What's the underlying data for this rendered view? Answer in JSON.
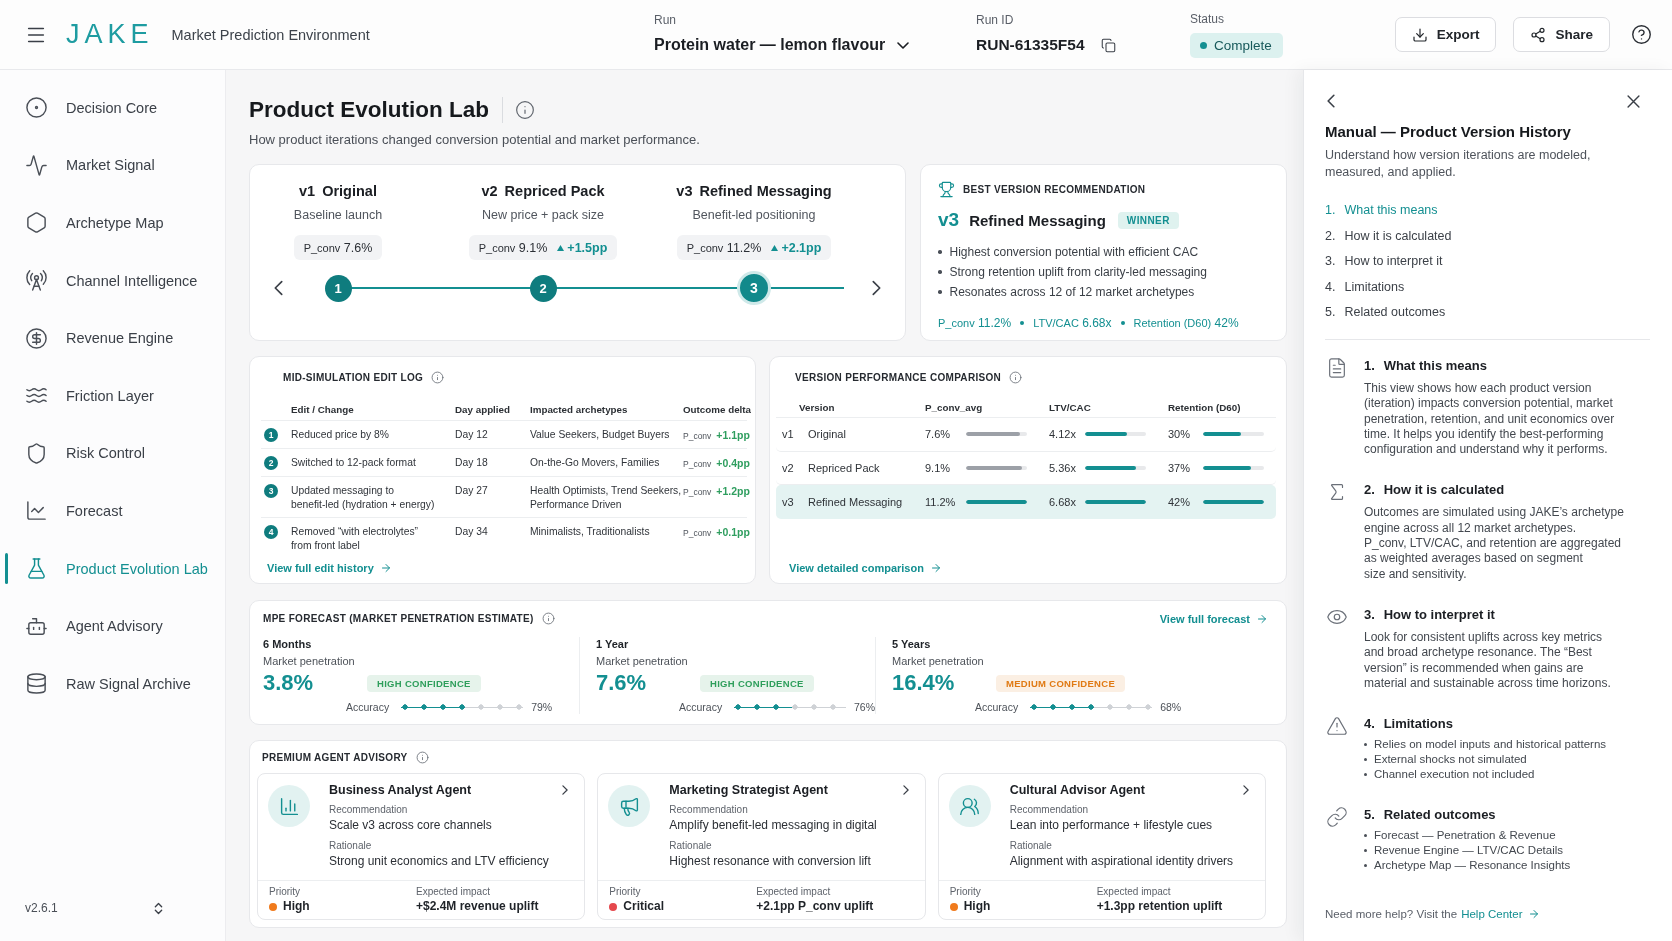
{
  "topbar": {
    "logo": "JAKE",
    "subtitle": "Market Prediction Environment",
    "run": {
      "label": "Run",
      "value": "Protein water — lemon flavour"
    },
    "run_id": {
      "label": "Run ID",
      "value": "RUN-61335F54"
    },
    "status": {
      "label": "Status",
      "value": "Complete"
    },
    "actions": [
      {
        "label": "Export"
      },
      {
        "label": "Share"
      }
    ]
  },
  "sidebar": {
    "items": [
      {
        "label": "Decision Core",
        "selected": false
      },
      {
        "label": "Market Signal",
        "selected": false
      },
      {
        "label": "Archetype Map",
        "selected": false
      },
      {
        "label": "Channel Intelligence",
        "selected": false
      },
      {
        "label": "Revenue Engine",
        "selected": false
      },
      {
        "label": "Friction Layer",
        "selected": false
      },
      {
        "label": "Risk Control",
        "selected": false
      },
      {
        "label": "Forecast",
        "selected": false
      },
      {
        "label": "Product Evolution Lab",
        "selected": true
      },
      {
        "label": "Agent Advisory",
        "selected": false
      },
      {
        "label": "Raw Signal Archive",
        "selected": false
      }
    ],
    "version": "v2.6.1"
  },
  "header": {
    "title": "Product Evolution Lab",
    "subtitle": "How product iterations changed conversion potential and market performance."
  },
  "timeline": {
    "versions": [
      {
        "tag": "v1",
        "name": "Original",
        "description": "Baseline launch",
        "metric": "P_conv",
        "value": "7.6%",
        "step": "1",
        "selected": false
      },
      {
        "tag": "v2",
        "name": "Repriced Pack",
        "description": "New price + pack size",
        "metric": "P_conv",
        "value": "9.1%",
        "delta": "+1.5pp",
        "step": "2",
        "selected": false
      },
      {
        "tag": "v3",
        "name": "Refined Messaging",
        "description": "Benefit-led positioning",
        "metric": "P_conv",
        "value": "11.2%",
        "delta": "+2.1pp",
        "step": "3",
        "selected": true
      }
    ]
  },
  "best_version": {
    "title": "BEST VERSION RECOMMENDATION",
    "tag": "v3",
    "name": "Refined Messaging",
    "badge": "WINNER",
    "points": [
      "Highest conversion potential with efficient CAC",
      "Strong retention uplift from clarity-led messaging",
      "Resonates across 12 of 12 market archetypes"
    ],
    "metrics": [
      {
        "label": "P_conv",
        "value": "11.2%"
      },
      {
        "label": "LTV/CAC",
        "value": "6.68x"
      },
      {
        "label": "Retention (D60)",
        "value": "42%"
      }
    ]
  },
  "edit_log": {
    "title": "MID-SIMULATION EDIT LOG",
    "columns": [
      "Edit / Change",
      "Day applied",
      "Impacted archetypes",
      "Outcome delta"
    ],
    "rows": [
      {
        "step": "1",
        "change": "Reduced price by 8%",
        "day": "Day 12",
        "archetypes": "Value Seekers, Budget Buyers",
        "metric": "P_conv",
        "delta": "+1.1pp"
      },
      {
        "step": "2",
        "change": "Switched to 12-pack format",
        "day": "Day 18",
        "archetypes": "On-the-Go Movers, Families",
        "metric": "P_conv",
        "delta": "+0.4pp"
      },
      {
        "step": "3",
        "change": "Updated messaging to\nbenefit-led (hydration + energy)",
        "day": "Day 27",
        "archetypes": "Health Optimists, Trend Seekers,\nPerformance Driven",
        "metric": "P_conv",
        "delta": "+1.2pp"
      },
      {
        "step": "4",
        "change": "Removed “with electrolytes”\nfrom front label",
        "day": "Day 34",
        "archetypes": "Minimalists, Traditionalists",
        "metric": "P_conv",
        "delta": "+0.1pp"
      }
    ],
    "link": "View full edit history"
  },
  "comparison": {
    "title": "VERSION PERFORMANCE COMPARISON",
    "columns": [
      "Version",
      "P_conv_avg",
      "LTV/CAC",
      "Retention (D60)"
    ],
    "rows": [
      {
        "tag": "v1",
        "name": "Original",
        "selected": false,
        "metrics": [
          {
            "value": "7.6%",
            "level": 0.88
          },
          {
            "value": "4.12x",
            "level": 0.69
          },
          {
            "value": "30%",
            "level": 0.63
          }
        ]
      },
      {
        "tag": "v2",
        "name": "Repriced Pack",
        "selected": false,
        "metrics": [
          {
            "value": "9.1%",
            "level": 0.92
          },
          {
            "value": "5.36x",
            "level": 0.83
          },
          {
            "value": "37%",
            "level": 0.79
          }
        ]
      },
      {
        "tag": "v3",
        "name": "Refined Messaging",
        "selected": true,
        "metrics": [
          {
            "value": "11.2%",
            "level": 1
          },
          {
            "value": "6.68x",
            "level": 1
          },
          {
            "value": "42%",
            "level": 1
          }
        ]
      }
    ],
    "link": "View detailed comparison"
  },
  "forecast": {
    "title": "MPE FORECAST (MARKET PENETRATION ESTIMATE)",
    "link": "View full forecast",
    "horizons": [
      {
        "period": "6 Months",
        "label": "Market penetration",
        "value": "3.8%",
        "confidence": "HIGH CONFIDENCE",
        "color": "#2e9e5b",
        "accuracy_label": "Accuracy",
        "accuracy": "79%",
        "level": 0.52
      },
      {
        "period": "1 Year",
        "label": "Market penetration",
        "value": "7.6%",
        "confidence": "HIGH CONFIDENCE",
        "color": "#2e9e5b",
        "accuracy_label": "Accuracy",
        "accuracy": "76%",
        "level": 0.52
      },
      {
        "period": "5 Years",
        "label": "Market penetration",
        "value": "16.4%",
        "confidence": "MEDIUM CONFIDENCE",
        "color": "#e07a14",
        "accuracy_label": "Accuracy",
        "accuracy": "68%",
        "level": 0.52
      }
    ]
  },
  "advisory": {
    "title": "PREMIUM AGENT ADVISORY",
    "agents": [
      {
        "name": "Business Analyst Agent",
        "recommendation_label": "Recommendation",
        "recommendation": "Scale v3 across core channels",
        "rationale_label": "Rationale",
        "rationale": "Strong unit economics and LTV efficiency",
        "priority_label": "Priority",
        "priority": "High",
        "color": "#f07a1c",
        "impact_label": "Expected impact",
        "impact": "+$2.4M revenue uplift"
      },
      {
        "name": "Marketing Strategist Agent",
        "recommendation_label": "Recommendation",
        "recommendation": "Amplify benefit-led messaging in digital",
        "rationale_label": "Rationale",
        "rationale": "Highest resonance with conversion lift",
        "priority_label": "Priority",
        "priority": "Critical",
        "color": "#e5484d",
        "impact_label": "Expected impact",
        "impact": "+2.1pp P_conv uplift"
      },
      {
        "name": "Cultural Advisor Agent",
        "recommendation_label": "Recommendation",
        "recommendation": "Lean into performance + lifestyle cues",
        "rationale_label": "Rationale",
        "rationale": "Alignment with aspirational identity drivers",
        "priority_label": "Priority",
        "priority": "High",
        "color": "#f07a1c",
        "impact_label": "Expected impact",
        "impact": "+1.3pp retention uplift"
      }
    ]
  },
  "manual": {
    "title": "Manual — Product Version History",
    "description": "Understand how version iterations are modeled,\nmeasured, and applied.",
    "toc": [
      {
        "number": "1.",
        "label": "What this means",
        "selected": true
      },
      {
        "number": "2.",
        "label": "How it is calculated",
        "selected": false
      },
      {
        "number": "3.",
        "label": "How to interpret it",
        "selected": false
      },
      {
        "number": "4.",
        "label": "Limitations",
        "selected": false
      },
      {
        "number": "5.",
        "label": "Related outcomes",
        "selected": false
      }
    ],
    "sections": [
      {
        "kind": "text",
        "number": "1.",
        "title": "What this means",
        "body": "This view shows how each product version\n(iteration) impacts conversion potential, market\npenetration, retention, and unit economics over\ntime. It helps you identify the best-performing\nconfiguration and understand why it performs."
      },
      {
        "kind": "text",
        "number": "2.",
        "title": "How it is calculated",
        "body": "Outcomes are simulated using JAKE’s archetype\nengine across all 12 market archetypes.\nP_conv, LTV/CAC, and retention are aggregated\nas weighted averages based on segment\nsize and sensitivity."
      },
      {
        "kind": "text",
        "number": "3.",
        "title": "How to interpret it",
        "body": "Look for consistent uplifts across key metrics\nand broad archetype resonance. The “Best\nversion” is recommended when gains are\nmaterial and sustainable across time horizons."
      },
      {
        "kind": "list",
        "number": "4.",
        "title": "Limitations",
        "bullets": [
          "Relies on model inputs and historical patterns",
          "External shocks not simulated",
          "Channel execution not included"
        ]
      },
      {
        "kind": "list",
        "number": "5.",
        "title": "Related outcomes",
        "bullets": [
          "Forecast — Penetration & Revenue",
          "Revenue Engine — LTV/CAC Details",
          "Archetype Map — Resonance Insights"
        ]
      }
    ],
    "help": {
      "text": "Need more help? Visit the",
      "link": "Help Center"
    }
  }
}
